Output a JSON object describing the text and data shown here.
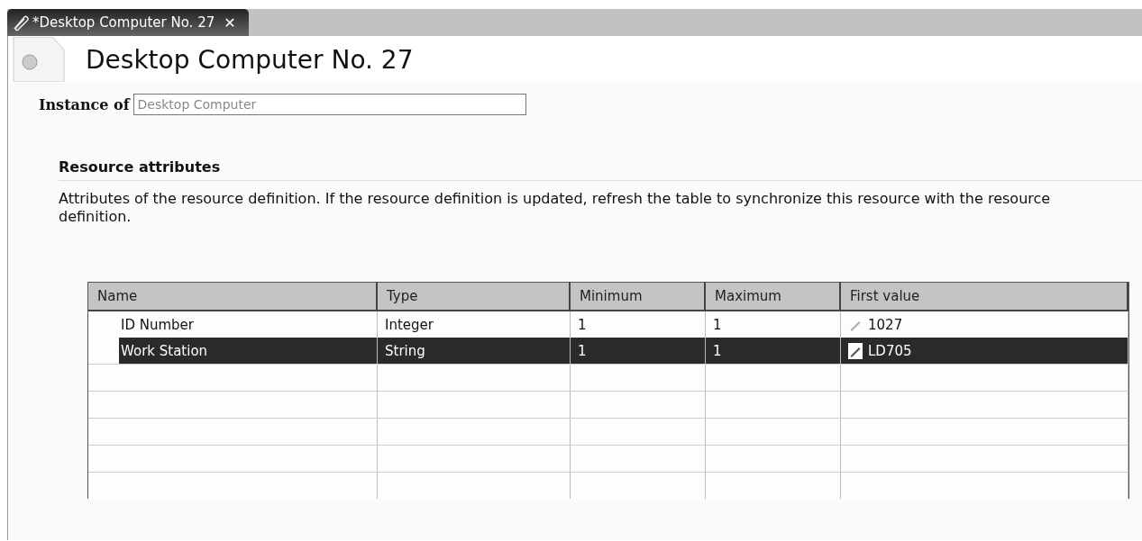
{
  "tab": {
    "title": "*Desktop Computer No. 27",
    "close": "✕",
    "selected": true
  },
  "header": {
    "title": "Desktop Computer No. 27"
  },
  "instance_of": {
    "label": "Instance of",
    "value": "Desktop Computer"
  },
  "section": {
    "title": "Resource attributes",
    "description": "Attributes of the resource definition. If the resource definition is updated, refresh the table to synchronize this resource with the resource definition."
  },
  "table": {
    "columns": [
      "Name",
      "Type",
      "Minimum",
      "Maximum",
      "First value"
    ],
    "rows": [
      {
        "name": "ID Number",
        "type": "Integer",
        "minimum": "1",
        "maximum": "1",
        "first_value": "1027",
        "selected": false
      },
      {
        "name": "Work Station",
        "type": "String",
        "minimum": "1",
        "maximum": "1",
        "first_value": "LD705",
        "selected": true
      }
    ]
  }
}
